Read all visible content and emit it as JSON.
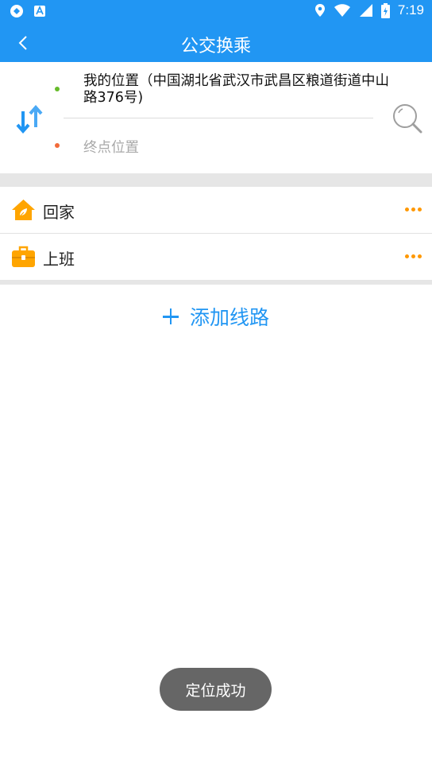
{
  "status_bar": {
    "time": "7:19",
    "left_icons": [
      "app-notification-icon",
      "a-notification-icon"
    ],
    "right_icons": [
      "location-icon",
      "wifi-icon",
      "signal-icon",
      "battery-icon"
    ]
  },
  "app_bar": {
    "title": "公交换乘",
    "back_icon": "chevron-left-icon"
  },
  "route": {
    "from_text": "我的位置（中国湖北省武汉市武昌区粮道街道中山路376号)",
    "to_placeholder": "终点位置",
    "swap_icon": "swap-arrows-icon",
    "search_icon": "search-icon"
  },
  "shortcuts": [
    {
      "label": "回家",
      "icon": "home-icon"
    },
    {
      "label": "上班",
      "icon": "briefcase-icon"
    }
  ],
  "add_route_label": "添加线路",
  "toast": "定位成功",
  "colors": {
    "primary": "#2196f3",
    "accent_orange": "#ff9800",
    "start_dot": "#66bb2a",
    "end_dot": "#f26b3a"
  }
}
